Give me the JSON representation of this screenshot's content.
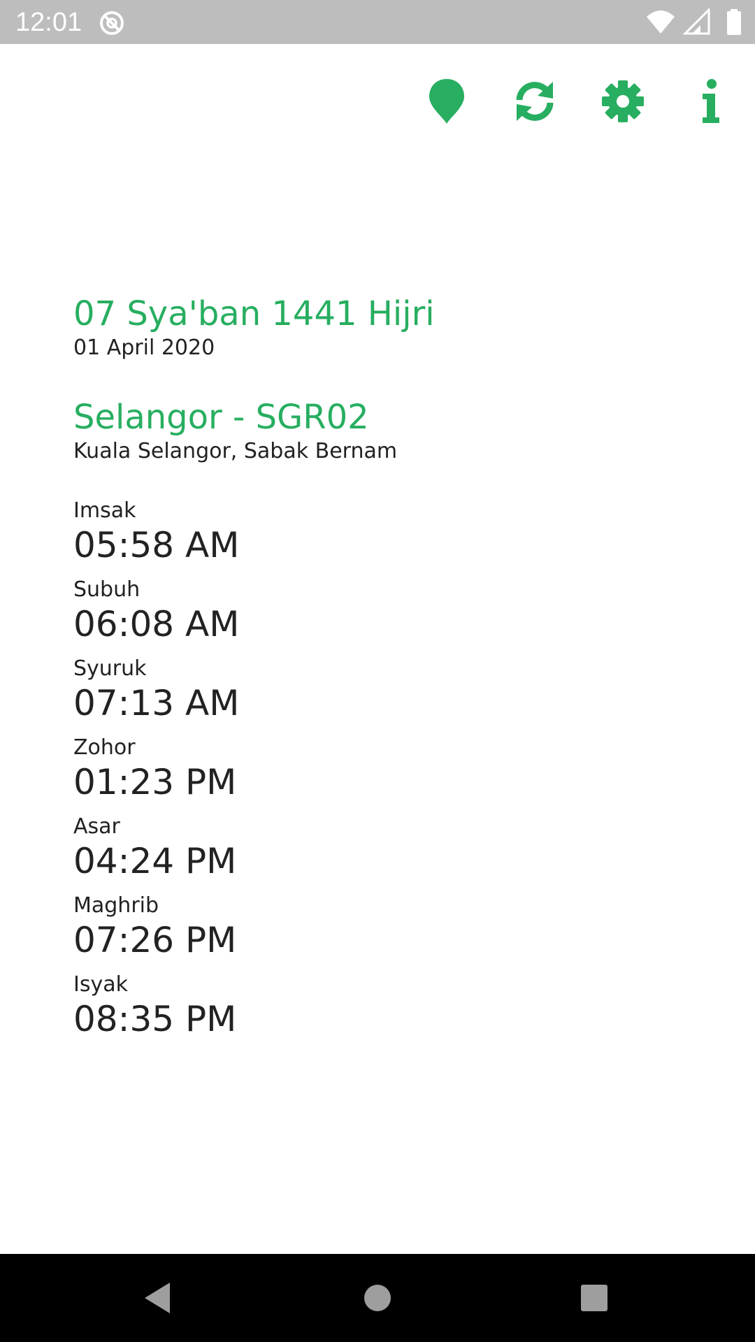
{
  "status_bar": {
    "time": "12:01",
    "icons": [
      "do-not-disturb-icon",
      "wifi-icon",
      "signal-icon",
      "battery-icon"
    ],
    "color": "#bdbdbd"
  },
  "toolbar": {
    "icons": [
      "location-pin-icon",
      "refresh-icon",
      "gear-icon",
      "info-icon"
    ],
    "accent_color": "#27ae60"
  },
  "date": {
    "hijri": "07 Sya'ban 1441 Hijri",
    "gregorian": "01 April 2020"
  },
  "zone": {
    "title": "Selangor - SGR02",
    "areas": "Kuala Selangor, Sabak Bernam"
  },
  "prayers": [
    {
      "name": "Imsak",
      "time": "05:58 AM"
    },
    {
      "name": "Subuh",
      "time": "06:08 AM"
    },
    {
      "name": "Syuruk",
      "time": "07:13 AM"
    },
    {
      "name": "Zohor",
      "time": "01:23 PM"
    },
    {
      "name": "Asar",
      "time": "04:24 PM"
    },
    {
      "name": "Maghrib",
      "time": "07:26 PM"
    },
    {
      "name": "Isyak",
      "time": "08:35 PM"
    }
  ],
  "nav_bar": {
    "icons": [
      "back-icon",
      "home-icon",
      "recents-icon"
    ]
  }
}
